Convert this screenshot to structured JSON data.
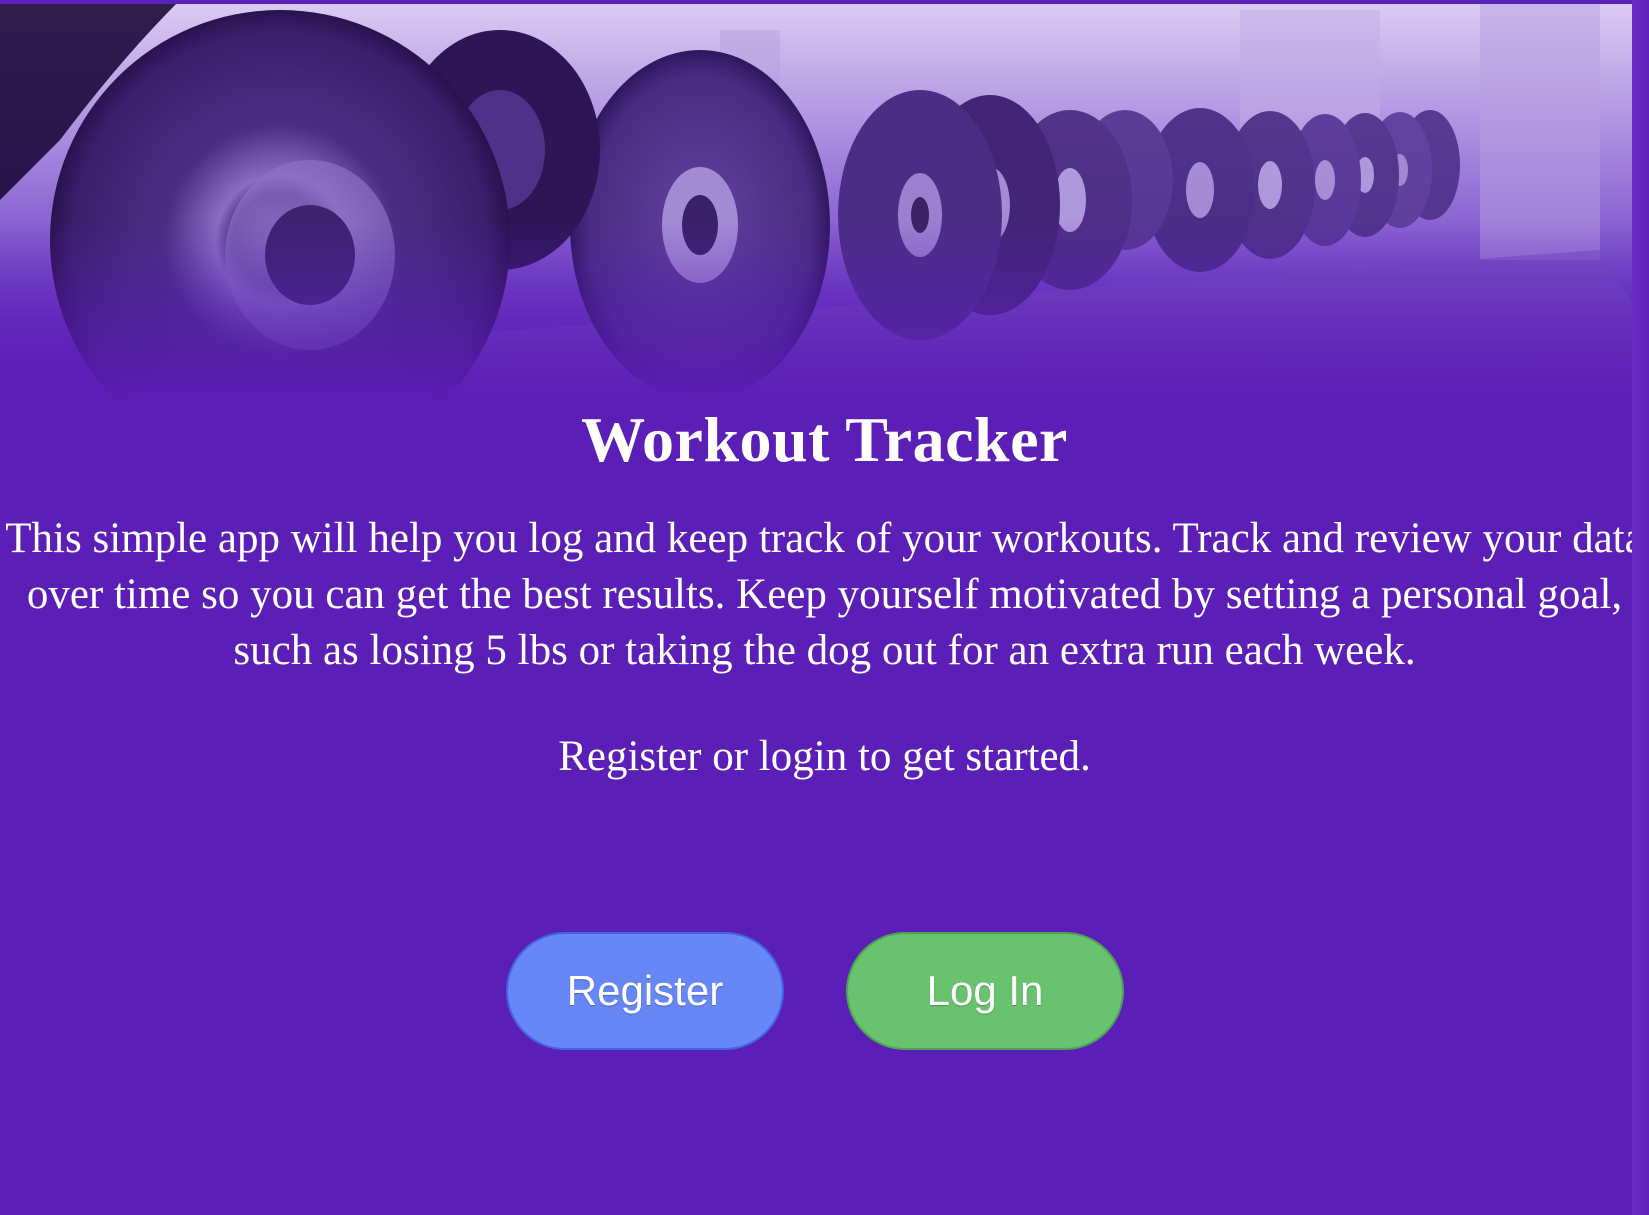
{
  "app": {
    "title": "Workout Tracker",
    "description": "This simple app will help you log and keep track of your workouts. Track and review your data over time so you can get the best results. Keep yourself motivated by setting a personal goal, such as losing 5 lbs or taking the dog out for an extra run each week.",
    "call_to_action": "Register or login to get started."
  },
  "buttons": {
    "register_label": "Register",
    "login_label": "Log In"
  },
  "hero": {
    "image_icon": "dumbbell-rack-photo"
  },
  "colors": {
    "background": "#5b1eb6",
    "register_button": "#6787f7",
    "login_button": "#69c26f",
    "text": "#ffffff"
  }
}
